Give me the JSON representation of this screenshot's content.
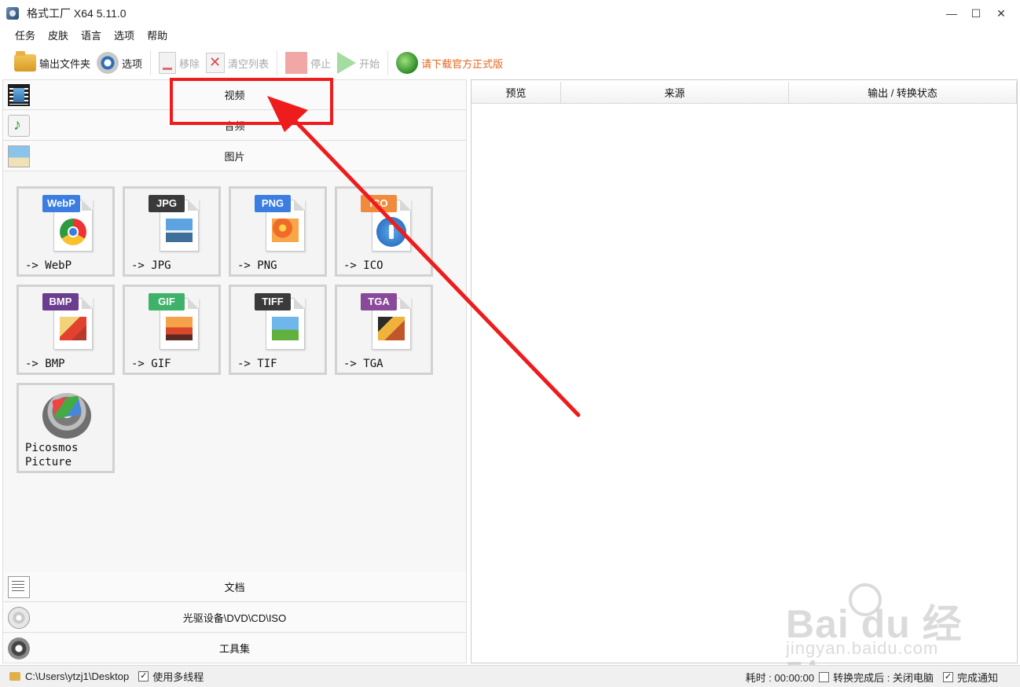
{
  "window": {
    "title": "格式工厂 X64 5.11.0",
    "controls": {
      "minimize": "—",
      "maximize": "☐",
      "close": "✕"
    }
  },
  "menu": {
    "items": [
      "任务",
      "皮肤",
      "语言",
      "选项",
      "帮助"
    ]
  },
  "toolbar": {
    "output_folder": "输出文件夹",
    "options": "选项",
    "remove": "移除",
    "clear_list": "清空列表",
    "stop": "停止",
    "start": "开始",
    "download_official": "请下载官方正式版",
    "link_color": "#e8641a"
  },
  "categories": {
    "video": "视频",
    "audio": "音频",
    "picture": "图片",
    "document": "文档",
    "disc": "光驱设备\\DVD\\CD\\ISO",
    "tools": "工具集"
  },
  "picture_formats": [
    {
      "badge": "WebP",
      "label": "-> WebP",
      "badge_color": "#3b7de0",
      "icon": "chrome-icon"
    },
    {
      "badge": "JPG",
      "label": "-> JPG",
      "badge_color": "#3a3a3a",
      "icon": "landscape-image-icon"
    },
    {
      "badge": "PNG",
      "label": "-> PNG",
      "badge_color": "#3b7de0",
      "icon": "flower-image-icon"
    },
    {
      "badge": "ICO",
      "label": "-> ICO",
      "badge_color": "#f08a3c",
      "icon": "info-circle-icon"
    },
    {
      "badge": "BMP",
      "label": "-> BMP",
      "badge_color": "#6b3d8f",
      "icon": "paint-image-icon"
    },
    {
      "badge": "GIF",
      "label": "-> GIF",
      "badge_color": "#3fb26a",
      "icon": "sunset-image-icon"
    },
    {
      "badge": "TIFF",
      "label": "-> TIF",
      "badge_color": "#3a3a3a",
      "icon": "landscape-image-icon"
    },
    {
      "badge": "TGA",
      "label": "-> TGA",
      "badge_color": "#8a4a9a",
      "icon": "art-image-icon"
    }
  ],
  "picosmos": {
    "line1": "Picosmos",
    "line2": "Picture"
  },
  "task_table": {
    "columns": [
      "预览",
      "来源",
      "输出 / 转换状态"
    ]
  },
  "status": {
    "path": "C:\\Users\\ytzj1\\Desktop",
    "multithread_label": "使用多线程",
    "multithread_checked": "✓",
    "elapsed": "耗时 : 00:00:00",
    "after_done_label": "转换完成后 : 关闭电脑",
    "after_done_checked": "",
    "notify_label": "完成通知",
    "notify_checked": "✓"
  },
  "watermark": {
    "main": "Bai  du 经验",
    "sub": "jingyan.baidu.com"
  }
}
